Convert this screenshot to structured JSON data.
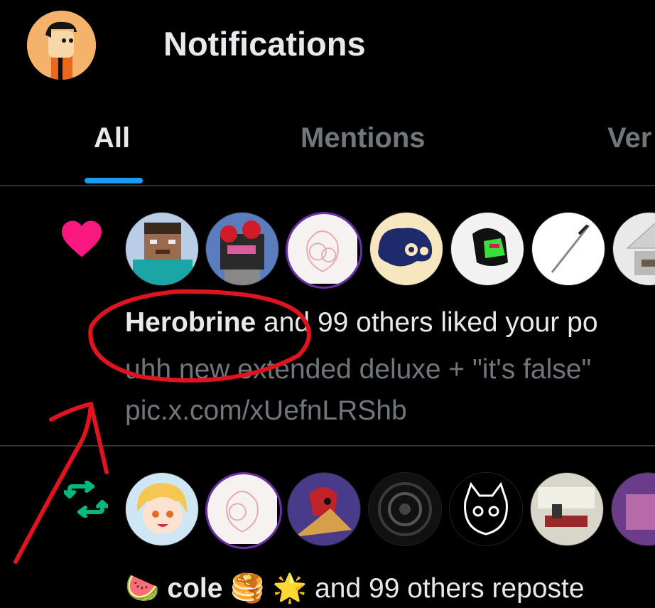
{
  "header": {
    "title": "Notifications"
  },
  "tabs": [
    {
      "label": "All"
    },
    {
      "label": "Mentions"
    },
    {
      "label": "Ver"
    }
  ],
  "notifications": [
    {
      "type": "like",
      "actor": "Herobrine",
      "rest": " and 99 others liked your po",
      "snippet": "uhh new extended deluxe + \"it's false\"",
      "link": "pic.x.com/xUefnLRShb"
    },
    {
      "type": "repost",
      "emoji_pre": "🍉",
      "actor": "cole",
      "emoji_post": "🥞 🌟",
      "rest": " and 99 others reposte"
    }
  ],
  "colors": {
    "like": "#f91880",
    "repost": "#00ba7c",
    "accent": "#1d9bf0",
    "annotation": "#e0141e"
  }
}
